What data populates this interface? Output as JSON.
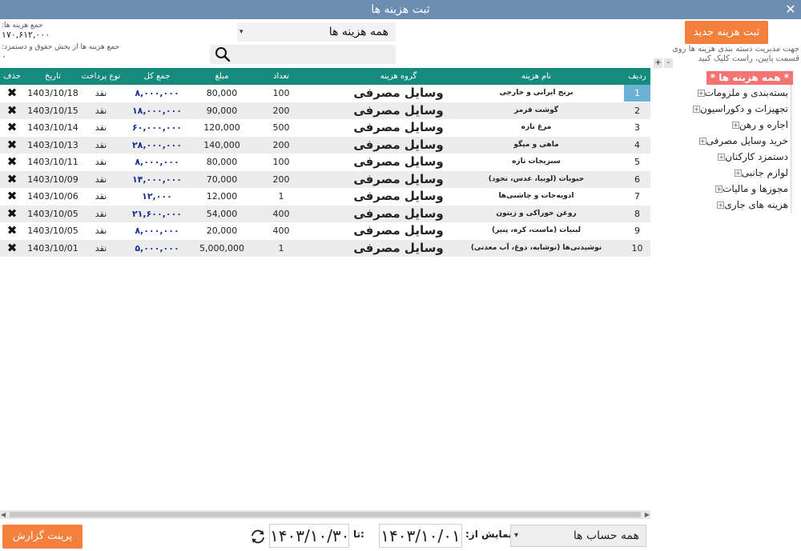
{
  "window": {
    "title": "ثبت هزینه ها",
    "close": "✕"
  },
  "summary": {
    "total_label": "جمع هزینه ها:",
    "total_value": "۱۷۰,۶۱۲,۰۰۰",
    "payroll_label": "جمع هزینه ها از بخش حقوق و دستمزد:",
    "payroll_value": "۰"
  },
  "filter": {
    "value": "همه هزینه ها",
    "arrow": "▾"
  },
  "search": {
    "placeholder": ""
  },
  "table": {
    "columns": [
      "ردیف",
      "نام هزینه",
      "گروه هزینه",
      "تعداد",
      "مبلغ",
      "جمع کل",
      "نوع پرداخت",
      "تاریخ",
      "حذف"
    ],
    "rows": [
      {
        "idx": "1",
        "name": "برنج ایرانی و خارجی",
        "group": "وسایل مصرفی",
        "qty": "100",
        "amount": "80,000",
        "total": "۸,۰۰۰,۰۰۰",
        "pay": "نقد",
        "date": "1403/10/18",
        "del": "✖"
      },
      {
        "idx": "2",
        "name": "گوشت قرمز",
        "group": "وسایل مصرفی",
        "qty": "200",
        "amount": "90,000",
        "total": "۱۸,۰۰۰,۰۰۰",
        "pay": "نقد",
        "date": "1403/10/15",
        "del": "✖"
      },
      {
        "idx": "3",
        "name": "مرغ تازه",
        "group": "وسایل مصرفی",
        "qty": "500",
        "amount": "120,000",
        "total": "۶۰,۰۰۰,۰۰۰",
        "pay": "نقد",
        "date": "1403/10/14",
        "del": "✖"
      },
      {
        "idx": "4",
        "name": "ماهی و میگو",
        "group": "وسایل مصرفی",
        "qty": "200",
        "amount": "140,000",
        "total": "۲۸,۰۰۰,۰۰۰",
        "pay": "نقد",
        "date": "1403/10/13",
        "del": "✖"
      },
      {
        "idx": "5",
        "name": "سبزیجات تازه",
        "group": "وسایل مصرفی",
        "qty": "100",
        "amount": "80,000",
        "total": "۸,۰۰۰,۰۰۰",
        "pay": "نقد",
        "date": "1403/10/11",
        "del": "✖"
      },
      {
        "idx": "6",
        "name": "حبوبات (لوبیا، عدس، نخود)",
        "group": "وسایل مصرفی",
        "qty": "200",
        "amount": "70,000",
        "total": "۱۴,۰۰۰,۰۰۰",
        "pay": "نقد",
        "date": "1403/10/09",
        "del": "✖"
      },
      {
        "idx": "7",
        "name": "ادویه‌جات و چاشنی‌ها",
        "group": "وسایل مصرفی",
        "qty": "1",
        "amount": "12,000",
        "total": "۱۲,۰۰۰",
        "pay": "نقد",
        "date": "1403/10/06",
        "del": "✖"
      },
      {
        "idx": "8",
        "name": "روغن خوراکی و زیتون",
        "group": "وسایل مصرفی",
        "qty": "400",
        "amount": "54,000",
        "total": "۲۱,۶۰۰,۰۰۰",
        "pay": "نقد",
        "date": "1403/10/05",
        "del": "✖"
      },
      {
        "idx": "9",
        "name": "لبنیات (ماست، کره، پنیر)",
        "group": "وسایل مصرفی",
        "qty": "400",
        "amount": "20,000",
        "total": "۸,۰۰۰,۰۰۰",
        "pay": "نقد",
        "date": "1403/10/05",
        "del": "✖"
      },
      {
        "idx": "10",
        "name": "نوشیدنی‌ها (نوشابه، دوغ، آب معدنی)",
        "group": "وسایل مصرفی",
        "qty": "1",
        "amount": "5,000,000",
        "total": "۵,۰۰۰,۰۰۰",
        "pay": "نقد",
        "date": "1403/10/01",
        "del": "✖"
      }
    ]
  },
  "right_panel": {
    "new_button": "ثبت هزینه جدید",
    "hint": "جهت مدیریت دسته بندی هزینه ها روی قسمت پایین، راست کلیک کنید",
    "plus": "+",
    "minus": "-",
    "root": "* همه هزینه ها *",
    "categories": [
      "بسته‌بندی و ملزومات",
      "تجهیزات و دکوراسیون",
      "اجاره و رهن",
      "خرید وسایل مصرفی",
      "دستمزد کارکنان",
      "لوازم جانبی",
      "مجوزها و مالیات",
      "هزینه های جاری"
    ]
  },
  "bottom": {
    "print_button": "پرینت گزارش",
    "date_to": "۱۴۰۳/۱۰/۳۰",
    "label_to": "تا:",
    "date_from": "۱۴۰۳/۱۰/۰۱",
    "label_from": "نمایش از:",
    "account_select": "همه حساب ها",
    "arrow": "▾"
  }
}
